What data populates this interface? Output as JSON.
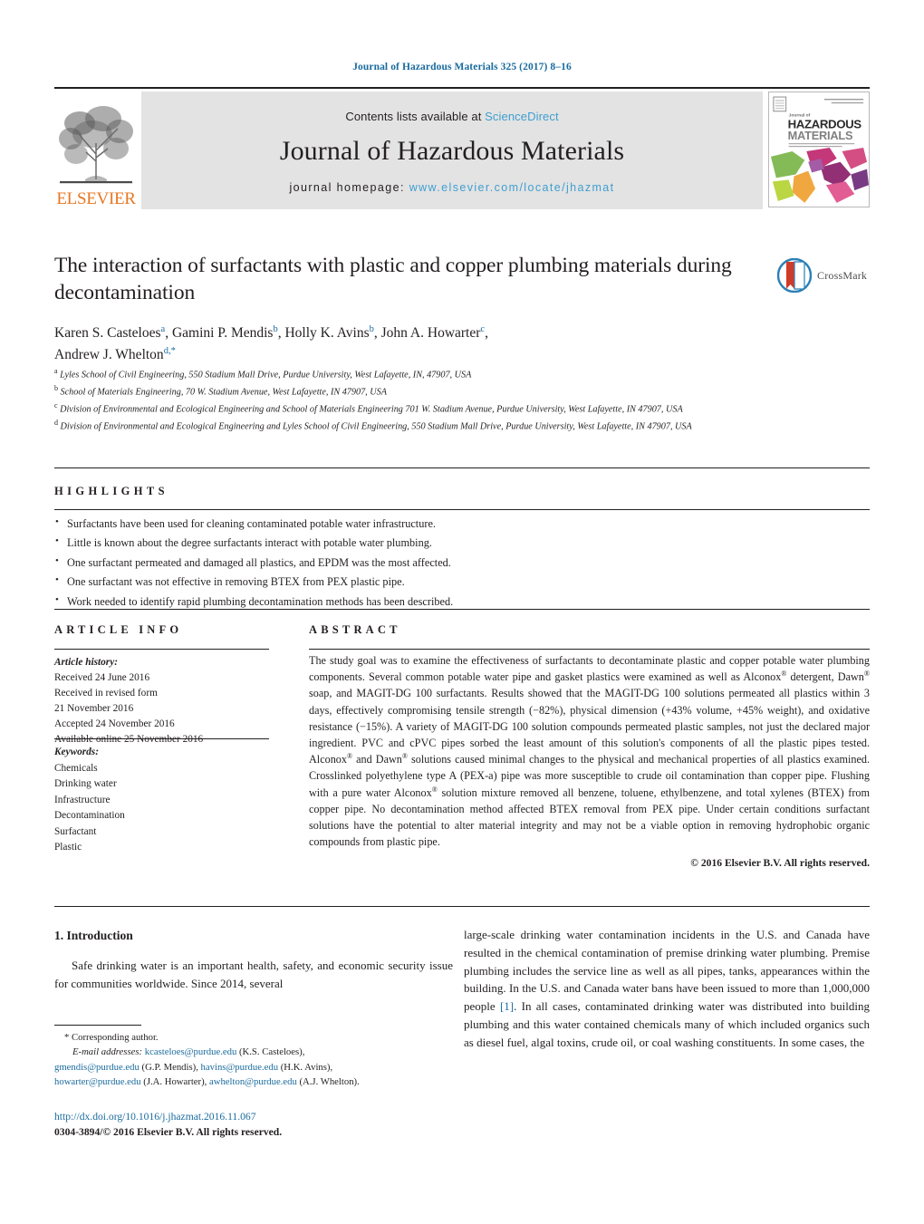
{
  "running_head": "Journal of Hazardous Materials 325 (2017) 8–16",
  "masthead": {
    "contents_prefix": "Contents lists available at ",
    "sciencedirect": "ScienceDirect",
    "journal_title": "Journal of Hazardous Materials",
    "homepage_prefix": "journal homepage: ",
    "homepage_url": "www.elsevier.com/locate/jhazmat",
    "publisher_logo_text": "ELSEVIER",
    "cover_title_line1": "HAZARDOUS",
    "cover_title_line2": "MATERIALS",
    "cover_kicker": "Journal of",
    "link_color": "#3f9fd0"
  },
  "crossmark": {
    "label": "CrossMark"
  },
  "article": {
    "title": "The interaction of surfactants with plastic and copper plumbing materials during decontamination",
    "authors": [
      {
        "name": "Karen S. Casteloes",
        "sup": "a",
        "sep": ","
      },
      {
        "name": "Gamini P. Mendis",
        "sup": "b",
        "sep": ","
      },
      {
        "name": "Holly K. Avins",
        "sup": "b",
        "sep": ","
      },
      {
        "name": "John A. Howarter",
        "sup": "c",
        "sep": ","
      },
      {
        "name": "Andrew J. Whelton",
        "sup": "d,*",
        "sep": ""
      }
    ],
    "affiliations": [
      {
        "marker": "a",
        "text": "Lyles School of Civil Engineering, 550 Stadium Mall Drive, Purdue University, West Lafayette, IN, 47907, USA"
      },
      {
        "marker": "b",
        "text": "School of Materials Engineering, 70 W. Stadium Avenue, West Lafayette, IN 47907, USA"
      },
      {
        "marker": "c",
        "text": "Division of Environmental and Ecological Engineering and School of Materials Engineering 701 W. Stadium Avenue, Purdue University, West Lafayette, IN 47907, USA"
      },
      {
        "marker": "d",
        "text": "Division of Environmental and Ecological Engineering and Lyles School of Civil Engineering, 550 Stadium Mall Drive, Purdue University, West Lafayette, IN 47907, USA"
      }
    ]
  },
  "highlights": {
    "heading": "HIGHLIGHTS",
    "items": [
      "Surfactants have been used for cleaning contaminated potable water infrastructure.",
      "Little is known about the degree surfactants interact with potable water plumbing.",
      "One surfactant permeated and damaged all plastics, and EPDM was the most affected.",
      "One surfactant was not effective in removing BTEX from PEX plastic pipe.",
      "Work needed to identify rapid plumbing decontamination methods has been described."
    ]
  },
  "article_info": {
    "heading": "ARTICLE INFO",
    "history_label": "Article history:",
    "history": [
      "Received 24 June 2016",
      "Received in revised form",
      "21 November 2016",
      "Accepted 24 November 2016",
      "Available online 25 November 2016"
    ],
    "keywords_label": "Keywords:",
    "keywords": [
      "Chemicals",
      "Drinking water",
      "Infrastructure",
      "Decontamination",
      "Surfactant",
      "Plastic"
    ]
  },
  "abstract": {
    "heading": "ABSTRACT",
    "paragraph_1": "The study goal was to examine the effectiveness of surfactants to decontaminate plastic and copper potable water plumbing components. Several common potable water pipe and gasket plastics were examined as well as Alconox",
    "paragraph_2": " detergent, Dawn",
    "paragraph_3": " soap, and MAGIT-DG 100 surfactants. Results showed that the MAGIT-DG 100 solutions permeated all plastics within 3 days, effectively compromising tensile strength (−82%), physical dimension (+43% volume, +45% weight), and oxidative resistance (−15%). A variety of MAGIT-DG 100 solution compounds permeated plastic samples, not just the declared major ingredient. PVC and cPVC pipes sorbed the least amount of this solution's components of all the plastic pipes tested. Alconox",
    "paragraph_4": " and Dawn",
    "paragraph_5": " solutions caused minimal changes to the physical and mechanical properties of all plastics examined. Crosslinked polyethylene type A (PEX-a) pipe was more susceptible to crude oil contamination than copper pipe. Flushing with a pure water Alconox",
    "paragraph_6": " solution mixture removed all benzene, toluene, ethylbenzene, and total xylenes (BTEX) from copper pipe. No decontamination method affected BTEX removal from PEX pipe. Under certain conditions surfactant solutions have the potential to alter material integrity and may not be a viable option in removing hydrophobic organic compounds from plastic pipe.",
    "registered_mark": "®",
    "copyright": "© 2016 Elsevier B.V. All rights reserved."
  },
  "body": {
    "section_number_title": "1. Introduction",
    "left_paragraph": "Safe drinking water is an important health, safety, and economic security issue for communities worldwide. Since 2014, several",
    "right_paragraph_a": "large-scale drinking water contamination incidents in the U.S. and Canada have resulted in the chemical contamination of premise drinking water plumbing. Premise plumbing includes the service line as well as all pipes, tanks, appearances within the building. In the U.S. and Canada water bans have been issued to more than 1,000,000 people ",
    "reference_marker": "[1]",
    "right_paragraph_b": ". In all cases, contaminated drinking water was distributed into building plumbing and this water contained chemicals many of which included organics such as diesel fuel, algal toxins, crude oil, or coal washing constituents. In some cases, the"
  },
  "footnote": {
    "corresponding": "* Corresponding author.",
    "email_label": "E-mail addresses:",
    "emails": [
      {
        "address": "kcasteloes@purdue.edu",
        "owner": " (K.S. Casteloes),"
      },
      {
        "address": "gmendis@purdue.edu",
        "owner": " (G.P. Mendis),"
      },
      {
        "address": "havins@purdue.edu",
        "owner": " (H.K. Avins),"
      },
      {
        "address": "howarter@purdue.edu",
        "owner": " (J.A. Howarter),"
      },
      {
        "address": "awhelton@purdue.edu",
        "owner": " (A.J. Whelton)."
      }
    ],
    "doi": "http://dx.doi.org/10.1016/j.jhazmat.2016.11.067",
    "issn_copyright": "0304-3894/© 2016 Elsevier B.V. All rights reserved."
  }
}
